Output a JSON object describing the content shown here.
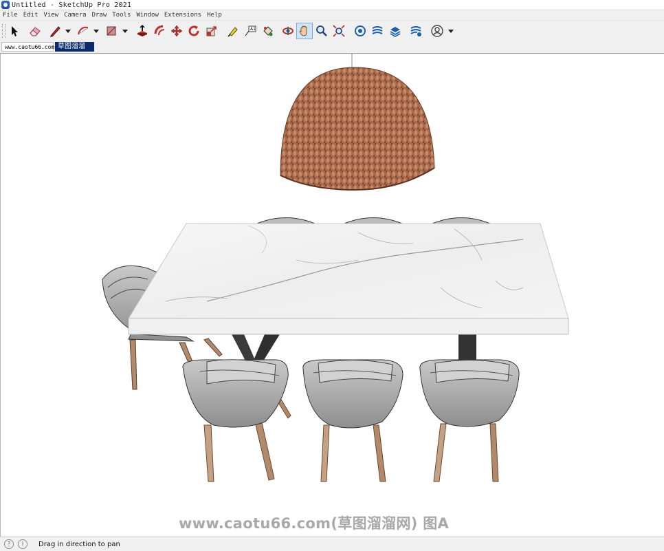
{
  "window": {
    "title": "Untitled - SketchUp Pro 2021"
  },
  "menu": [
    "File",
    "Edit",
    "View",
    "Camera",
    "Draw",
    "Tools",
    "Window",
    "Extensions",
    "Help"
  ],
  "toolbar": {
    "tools": [
      {
        "name": "select-tool-icon"
      },
      {
        "name": "eraser-tool-icon"
      },
      {
        "name": "line-tool-icon"
      },
      {
        "name": "arc-tool-icon"
      },
      {
        "name": "rectangle-tool-icon"
      },
      {
        "name": "push-pull-tool-icon"
      },
      {
        "name": "offset-tool-icon"
      },
      {
        "name": "move-tool-icon"
      },
      {
        "name": "rotate-tool-icon"
      },
      {
        "name": "scale-tool-icon"
      },
      {
        "name": "tape-measure-tool-icon"
      },
      {
        "name": "text-tool-icon"
      },
      {
        "name": "paint-bucket-tool-icon"
      },
      {
        "name": "orbit-tool-icon"
      },
      {
        "name": "pan-tool-icon",
        "active": true
      },
      {
        "name": "zoom-tool-icon"
      },
      {
        "name": "zoom-extents-tool-icon"
      },
      {
        "name": "3d-warehouse-icon"
      },
      {
        "name": "extension-warehouse-icon"
      },
      {
        "name": "layout-icon"
      },
      {
        "name": "extension-manager-icon"
      },
      {
        "name": "account-icon"
      }
    ],
    "text_tool_label": "A1"
  },
  "tabs": [
    {
      "label": "www.caotu66.com"
    },
    {
      "label": "草图溜溜网"
    }
  ],
  "viewport": {
    "watermark": "www.caotu66.com(草图溜溜网) 图A",
    "scene_objects": [
      "rattan-dome-pendant-lamp",
      "marble-dining-table",
      "upholstered-dining-chair"
    ]
  },
  "status": {
    "text": "Drag in direction to pan"
  },
  "colors": {
    "accent_active": "#cfe3f7",
    "tab_active_bg": "#0a2a6b",
    "viewport_bg": "#ffffff",
    "chair_fabric": "#a6a6a6",
    "chair_legs": "#b08a6a",
    "lamp_rattan": "#a86a4a",
    "table_base": "#3a3a3a",
    "table_marble": "#f2f2f2"
  }
}
